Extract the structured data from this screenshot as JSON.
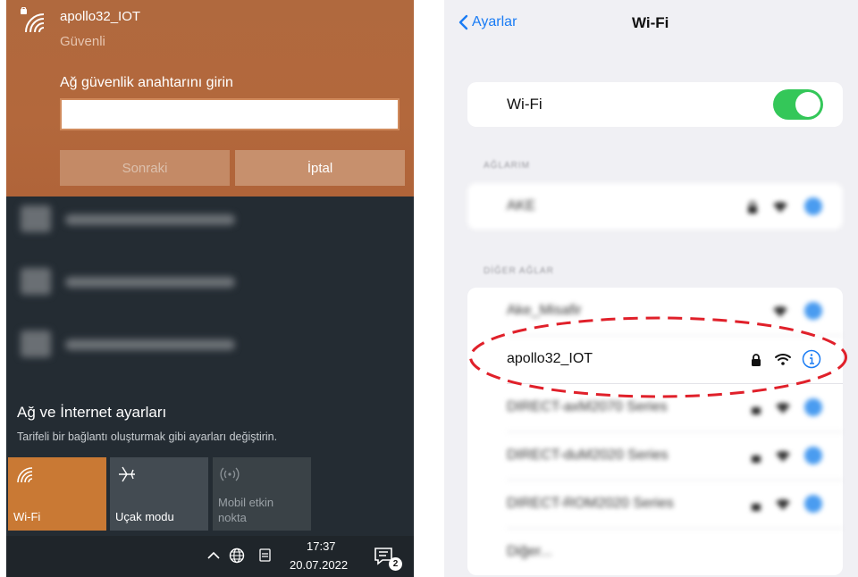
{
  "windows": {
    "network": {
      "name": "apollo32_IOT",
      "status": "Güvenli"
    },
    "key_prompt": {
      "label": "Ağ güvenlik anahtarını girin",
      "value": "",
      "placeholder": ""
    },
    "buttons": {
      "next": "Sonraki",
      "cancel": "İptal"
    },
    "settings": {
      "title": "Ağ ve İnternet ayarları",
      "subtitle": "Tarifeli bir bağlantı oluşturmak gibi ayarları değiştirin."
    },
    "tiles": [
      {
        "label": "Wi-Fi",
        "icon": "wifi-icon",
        "active": true
      },
      {
        "label": "Uçak modu",
        "icon": "airplane-icon",
        "active": false
      },
      {
        "label": "Mobil etkin nokta",
        "icon": "hotspot-icon",
        "active": false
      }
    ],
    "taskbar": {
      "time": "17:37",
      "date": "20.07.2022",
      "notification_count": "2"
    },
    "colors": {
      "panel_accent": "#b3683c",
      "wifi_tile": "#c97934"
    }
  },
  "ios": {
    "back_label": "Ayarlar",
    "title": "Wi-Fi",
    "wifi_label": "Wi-Fi",
    "wifi_enabled": true,
    "my_networks_header": "AĞLARIM",
    "other_networks_header": "DİĞER AĞLAR",
    "my_networks": [
      {
        "name": "AKE"
      }
    ],
    "other_networks": [
      {
        "name": "Ake_Misafir"
      },
      {
        "name": "apollo32_IOT"
      },
      {
        "name": "DIRECT-axM2070 Series"
      },
      {
        "name": "DIRECT-duM2020 Series"
      },
      {
        "name": "DIRECT-ROM2020 Series"
      },
      {
        "name": "Diğer..."
      }
    ],
    "colors": {
      "accent": "#1a7cf4",
      "toggle_on": "#34c759",
      "highlight": "#e0202a"
    }
  }
}
